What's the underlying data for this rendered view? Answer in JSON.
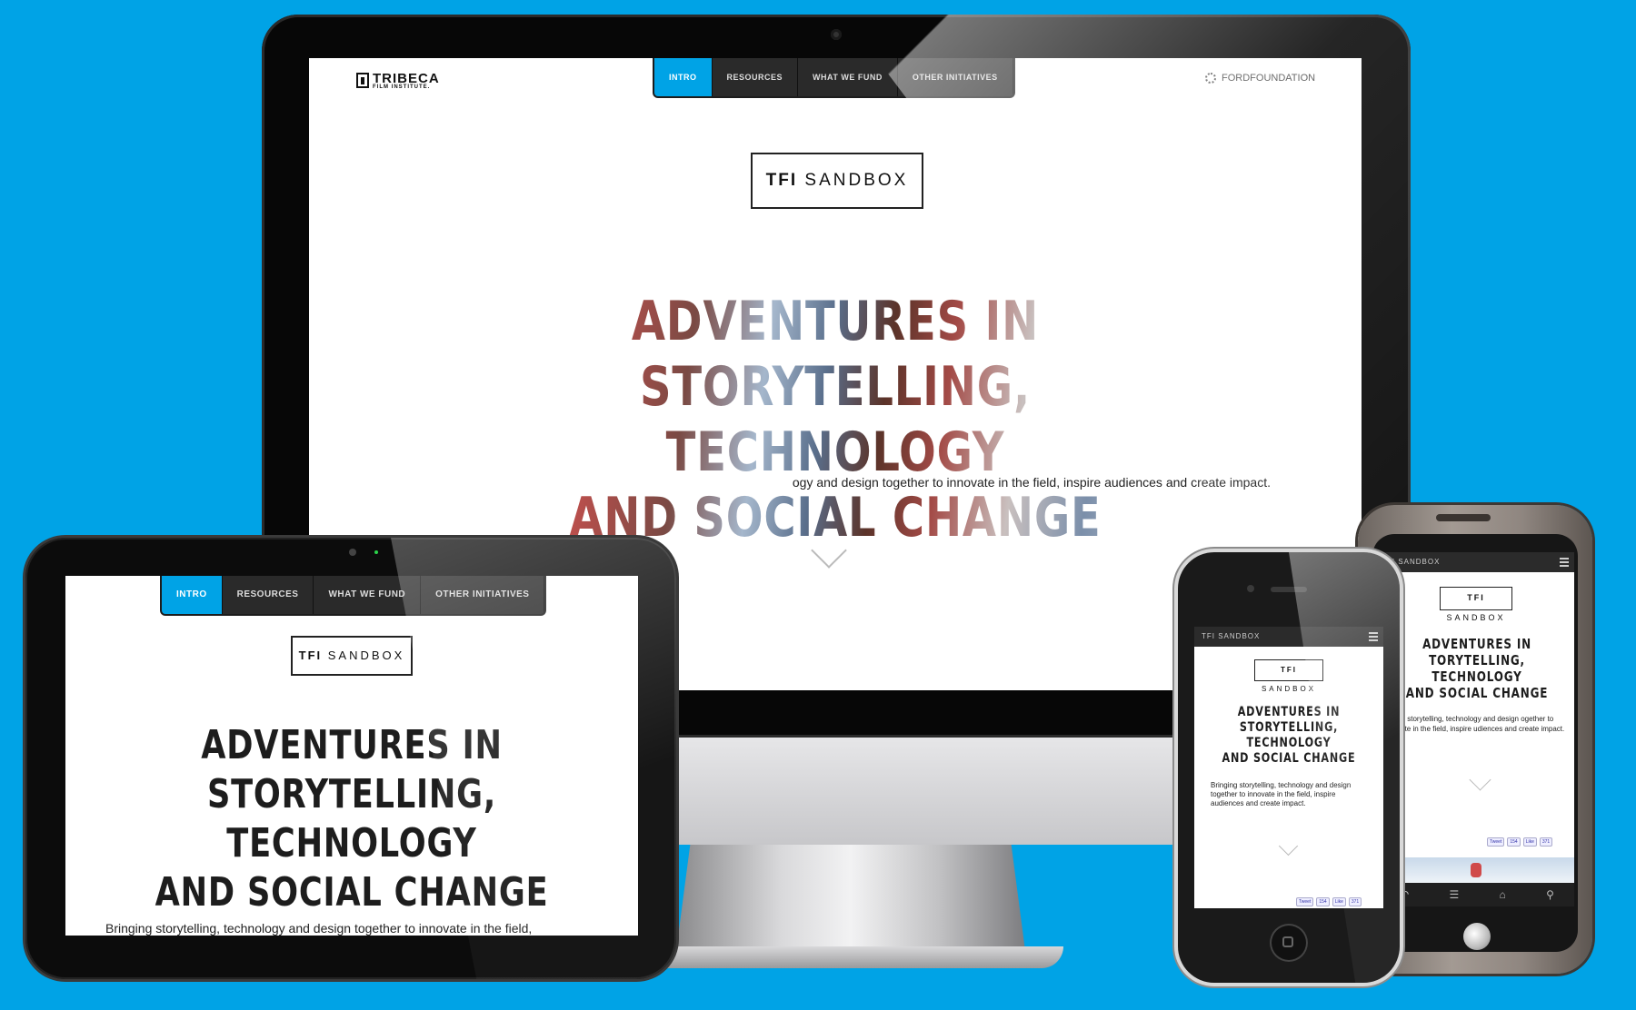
{
  "colors": {
    "background": "#00a3e6",
    "accent": "#00a3e6",
    "nav_bg": "#2a2a2a"
  },
  "desktop": {
    "logo": {
      "name": "TRIBECA",
      "sub": "FILM INSTITUTE."
    },
    "nav": [
      "INTRO",
      "RESOURCES",
      "WHAT WE FUND",
      "OTHER INITIATIVES"
    ],
    "partner": "FORDFOUNDATION",
    "sandbox": {
      "bold": "TFI",
      "rest": "SANDBOX"
    },
    "headline": [
      "ADVENTURES IN",
      "STORYTELLING, TECHNOLOGY",
      "AND SOCIAL CHANGE"
    ],
    "body": "ogy and design together to innovate in the field, inspire audiences and create impact."
  },
  "tablet": {
    "nav": [
      "INTRO",
      "RESOURCES",
      "WHAT WE FUND",
      "OTHER INITIATIVES"
    ],
    "sandbox": {
      "bold": "TFI",
      "rest": "SANDBOX"
    },
    "headline": [
      "ADVENTURES IN",
      "STORYTELLING, TECHNOLOGY",
      "AND SOCIAL CHANGE"
    ],
    "body": "Bringing storytelling, technology and design together to innovate in the field,"
  },
  "iphone": {
    "bar_title": "TFI SANDBOX",
    "sandbox": {
      "bold": "TFI",
      "rest": "SANDBOX"
    },
    "headline": [
      "ADVENTURES IN",
      "STORYTELLING, TECHNOLOGY",
      "AND SOCIAL CHANGE"
    ],
    "body": "Bringing storytelling, technology and design together to innovate in the field, inspire audiences and create impact.",
    "share": {
      "tweet": "Tweet",
      "tweet_count": "154",
      "like": "Like",
      "like_count": "371"
    }
  },
  "android": {
    "bar_title": "FI SANDBOX",
    "sandbox": {
      "bold": "TFI",
      "rest": "SANDBOX"
    },
    "headline": [
      "ADVENTURES IN",
      "TORYTELLING, TECHNOLOGY",
      "AND SOCIAL CHANGE"
    ],
    "body": "ringing storytelling, technology and design ogether to innovate in the field, inspire udiences and create impact.",
    "share": {
      "tweet": "Tweet",
      "tweet_count": "154",
      "like": "Like",
      "like_count": "371"
    }
  }
}
